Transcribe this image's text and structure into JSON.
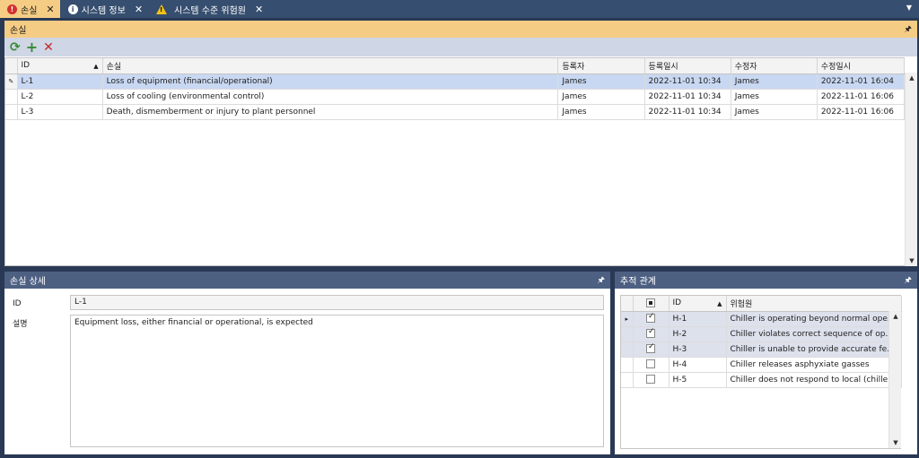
{
  "tabs": [
    {
      "label": "손실",
      "icon": "error-icon",
      "active": true
    },
    {
      "label": "시스템 정보",
      "icon": "info-icon",
      "active": false
    },
    {
      "label": "시스템 수준 위험원",
      "icon": "warning-icon",
      "active": false
    }
  ],
  "losses_panel": {
    "title": "손실",
    "columns": [
      "ID",
      "손실",
      "등록자",
      "등록일시",
      "수정자",
      "수정일시"
    ],
    "rows": [
      {
        "id": "L-1",
        "loss": "Loss of equipment (financial/operational)",
        "registrant": "James",
        "registered": "2022-11-01 10:34",
        "modifier": "James",
        "modified": "2022-11-01 16:04"
      },
      {
        "id": "L-2",
        "loss": "Loss of cooling (environmental control)",
        "registrant": "James",
        "registered": "2022-11-01 10:34",
        "modifier": "James",
        "modified": "2022-11-01 16:06"
      },
      {
        "id": "L-3",
        "loss": "Death, dismemberment or injury to plant personnel",
        "registrant": "James",
        "registered": "2022-11-01 10:34",
        "modifier": "James",
        "modified": "2022-11-01 16:06"
      }
    ]
  },
  "detail_panel": {
    "title": "손실 상세",
    "id_label": "ID",
    "id_value": "L-1",
    "desc_label": "설명",
    "desc_value": "Equipment loss, either financial or operational, is expected"
  },
  "trace_panel": {
    "title": "추적 관계",
    "columns": [
      "ID",
      "위험원"
    ],
    "rows": [
      {
        "checked": true,
        "id": "H-1",
        "hazard": "Chiller is operating beyond normal ope..."
      },
      {
        "checked": true,
        "id": "H-2",
        "hazard": "Chiller violates correct sequence of ope..."
      },
      {
        "checked": true,
        "id": "H-3",
        "hazard": "Chiller is unable to provide accurate fe..."
      },
      {
        "checked": false,
        "id": "H-4",
        "hazard": "Chiller releases asphyxiate gasses"
      },
      {
        "checked": false,
        "id": "H-5",
        "hazard": "Chiller does not respond to local (chille..."
      }
    ]
  },
  "colors": {
    "background": "#293955",
    "active_header": "#f5cc84",
    "inactive_header": "#4d6082",
    "selection": "#c9d8f2"
  }
}
